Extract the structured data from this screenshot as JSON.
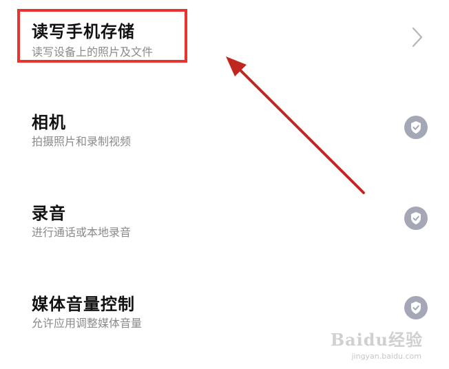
{
  "permissions": [
    {
      "title": "读写手机存储",
      "description": "读写设备上的照片及文件",
      "control_icon": "chevron-right-icon"
    },
    {
      "title": "相机",
      "description": "拍摄照片和录制视频",
      "control_icon": "check-circle-icon"
    },
    {
      "title": "录音",
      "description": "进行通话或本地录音",
      "control_icon": "check-circle-icon"
    },
    {
      "title": "媒体音量控制",
      "description": "允许应用调整媒体音量",
      "control_icon": "check-circle-icon"
    }
  ],
  "annotation": {
    "color": "#e8332f",
    "arrow_color": "#c0271f"
  },
  "colors": {
    "title": "#111111",
    "description": "#8a8a8a",
    "check_circle": "#a3a7b6",
    "chevron": "#b5b5b5"
  },
  "watermark": {
    "main": "Baidu经验",
    "sub": "jingyan.baidu.com"
  }
}
